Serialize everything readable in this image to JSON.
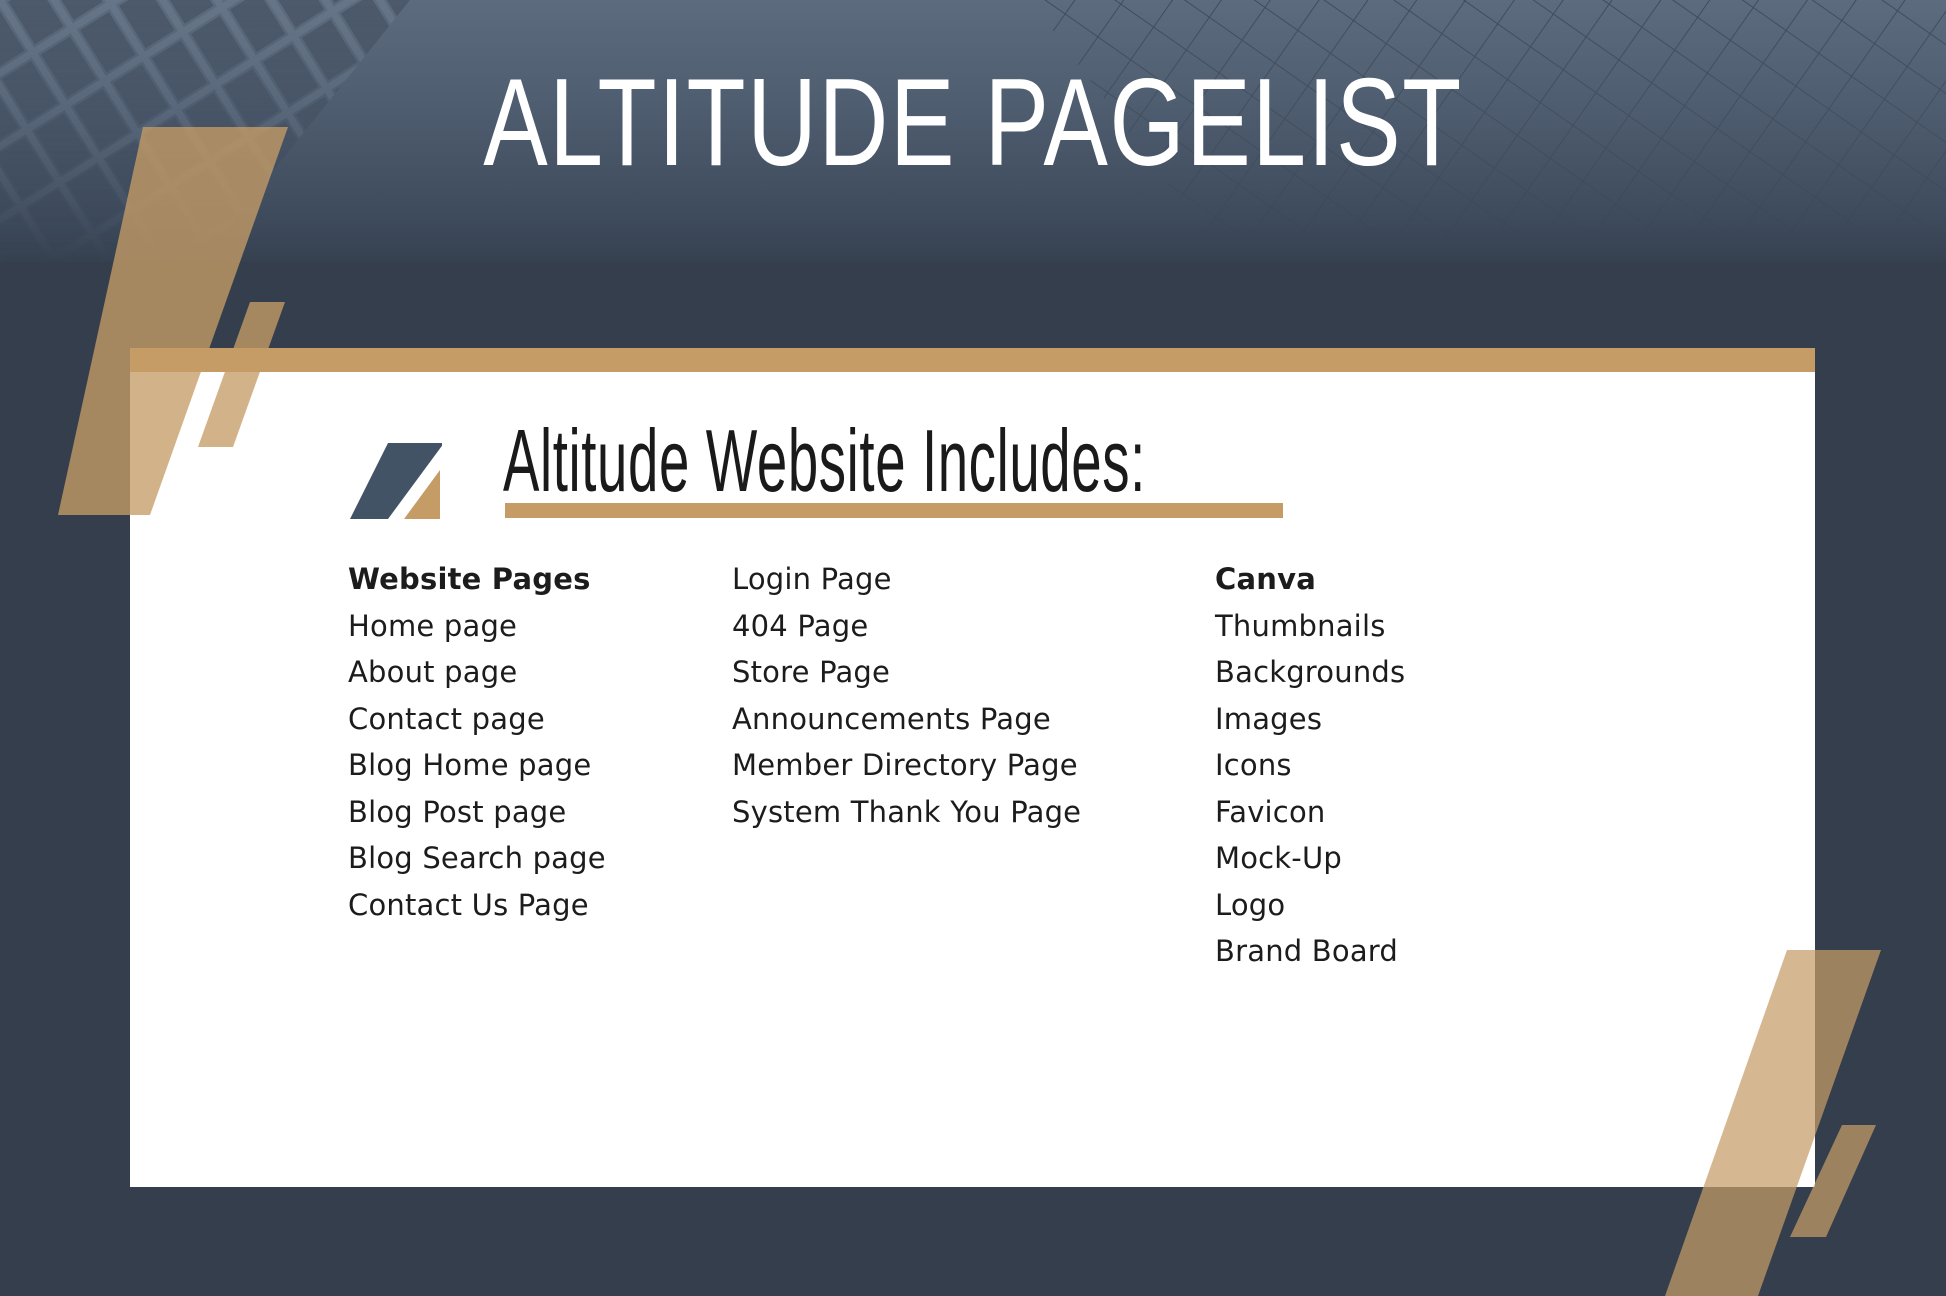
{
  "header": {
    "title": "ALTITUDE PAGELIST"
  },
  "card": {
    "heading": "Altitude Website Includes:",
    "columns": [
      {
        "header": "Website Pages",
        "items": [
          "Home page",
          "About page",
          "Contact page",
          "Blog Home page",
          "Blog Post page",
          "Blog Search page",
          "Contact Us Page"
        ]
      },
      {
        "header": "",
        "items": [
          "Login Page",
          "404 Page",
          "Store Page",
          "Announcements Page",
          "Member Directory Page",
          "System Thank You Page"
        ]
      },
      {
        "header": "Canva",
        "items": [
          "Thumbnails",
          "Backgrounds",
          "Images",
          "Icons",
          "Favicon",
          "Mock-Up",
          "Logo",
          "Brand Board"
        ]
      }
    ]
  },
  "colors": {
    "background": "#343e4c",
    "accent_gold": "#c59c66",
    "accent_gold_dark": "#a3845f",
    "accent_gold_light": "#d4b48b",
    "logo_slate": "#435366",
    "text": "#1c1c1c"
  }
}
